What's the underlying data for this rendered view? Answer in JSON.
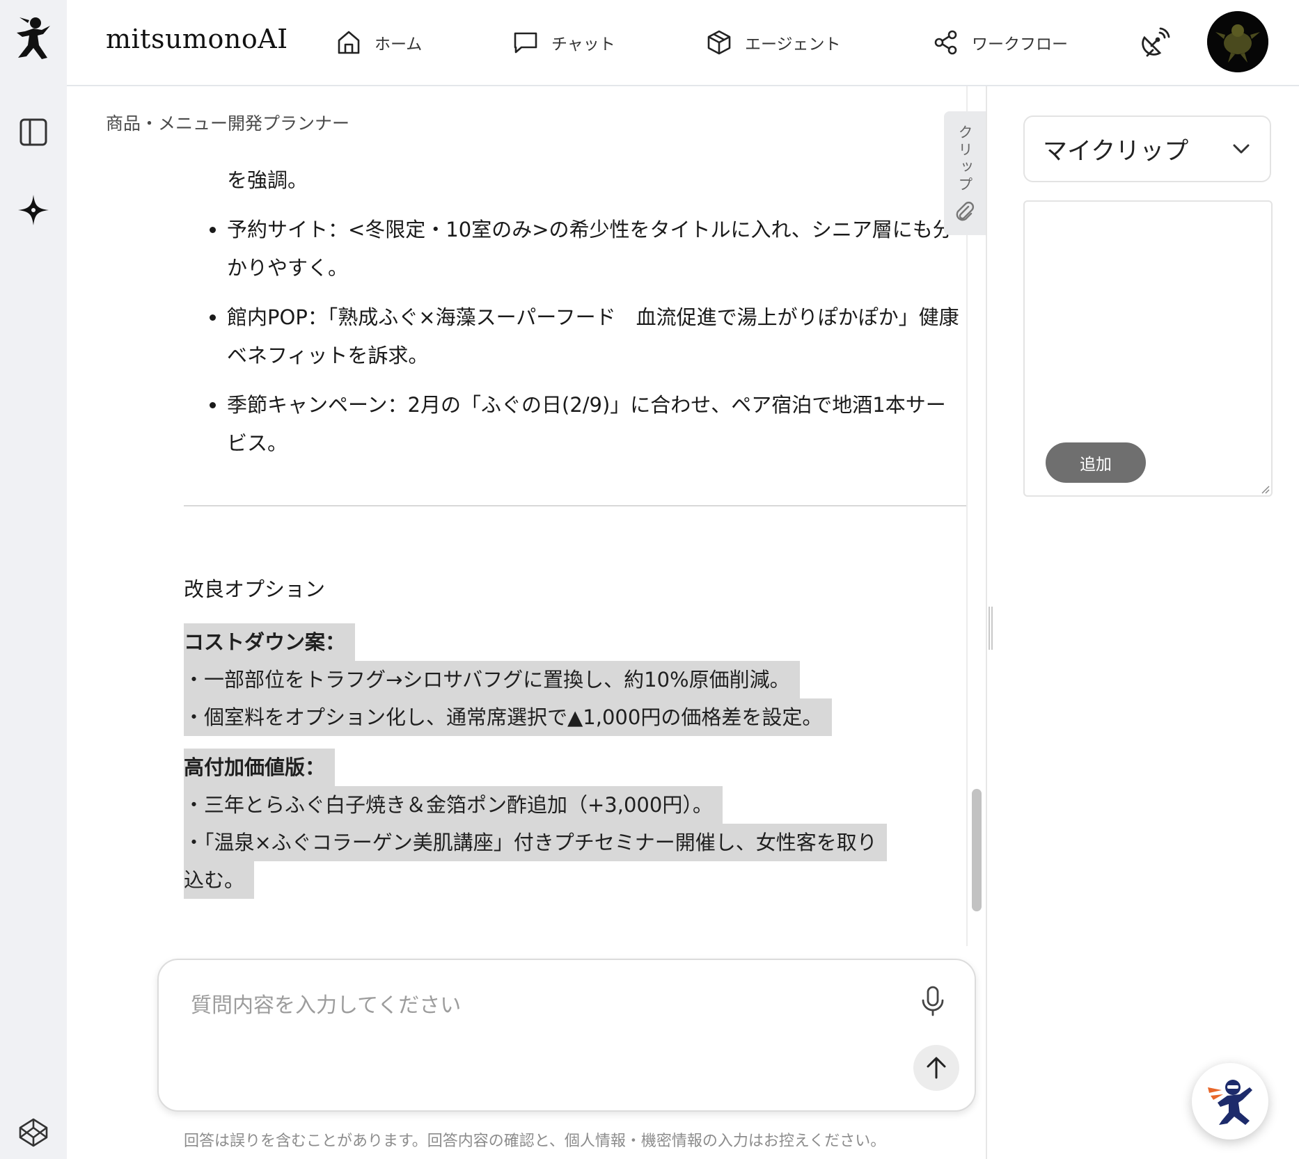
{
  "app": {
    "brand": "mitsumonoAI"
  },
  "nav": [
    {
      "label": "ホーム"
    },
    {
      "label": "チャット"
    },
    {
      "label": "エージェント"
    },
    {
      "label": "ワークフロー"
    }
  ],
  "main": {
    "breadcrumb": "商品・メニュー開発プランナー",
    "partial_line": "を強調。",
    "bullets": [
      "予約サイト：<冬限定・10室のみ>の希少性をタイトルに入れ、シニア層にも分かりやすく。",
      "館内POP：「熟成ふぐ×海藻スーパーフード　血流促進で湯上がりぽかぽか」健康ベネフィットを訴求。",
      "季節キャンペーン：2月の「ふぐの日(2/9)」に合わせ、ペア宿泊で地酒1本サービス。"
    ],
    "section_title": "改良オプション",
    "cost_down": {
      "heading": "コストダウン案：",
      "lines": [
        "・一部部位をトラフグ→シロサバフグに置換し、約10%原価削減。",
        "・個室料をオプション化し、通常席選択で▲1,000円の価格差を設定。"
      ]
    },
    "premium": {
      "heading": "高付加価値版：",
      "lines": [
        "・三年とらふぐ白子焼き＆金箔ポン酢追加（+3,000円）。",
        "・「温泉×ふぐコラーゲン美肌講座」付きプチセミナー開催し、女性客を取り",
        "込む。"
      ]
    },
    "clip_tab": "クリップ"
  },
  "input": {
    "placeholder": "質問内容を入力してください",
    "disclaimer": "回答は誤りを含むことがあります。回答内容の確認と、個人情報・機密情報の入力はお控えください。"
  },
  "right_panel": {
    "select_value": "マイクリップ",
    "add_label": "追加"
  },
  "icons": {
    "logo": "ninja-logo-icon",
    "sidebar_toggle": "sidebar-toggle-icon",
    "sparkle": "sparkle-icon",
    "home": "home-icon",
    "chat": "chat-bubble-icon",
    "agent": "cube-icon",
    "workflow": "share-nodes-icon",
    "satellite": "satellite-dish-icon",
    "codepen": "codepen-icon",
    "mic": "microphone-icon",
    "send": "arrow-up-icon",
    "clip": "paperclip-icon",
    "chevron": "chevron-down-icon"
  }
}
